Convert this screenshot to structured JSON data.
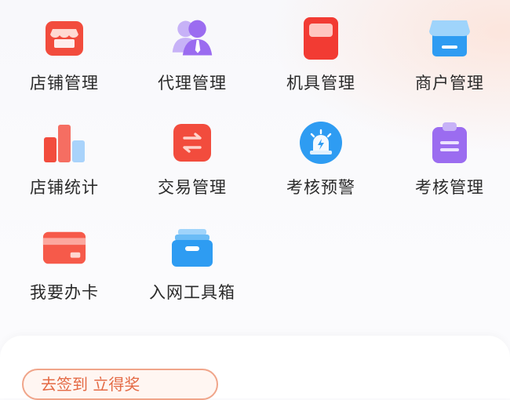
{
  "menu": {
    "items": [
      {
        "label": "店铺管理",
        "icon": "store-icon"
      },
      {
        "label": "代理管理",
        "icon": "agent-user-icon"
      },
      {
        "label": "机具管理",
        "icon": "pos-device-icon"
      },
      {
        "label": "商户管理",
        "icon": "merchant-shop-icon"
      },
      {
        "label": "店铺统计",
        "icon": "bar-chart-icon"
      },
      {
        "label": "交易管理",
        "icon": "exchange-icon"
      },
      {
        "label": "考核预警",
        "icon": "alarm-light-icon"
      },
      {
        "label": "考核管理",
        "icon": "clipboard-icon"
      },
      {
        "label": "我要办卡",
        "icon": "credit-card-icon"
      },
      {
        "label": "入网工具箱",
        "icon": "toolbox-icon"
      }
    ]
  },
  "bottom": {
    "button_label": "去签到 立得奖"
  },
  "colors": {
    "red": "#f24c3d",
    "purple": "#9b6cf0",
    "blue": "#2e9cf2",
    "text": "#2a2a2a",
    "accent": "#e46a45"
  }
}
